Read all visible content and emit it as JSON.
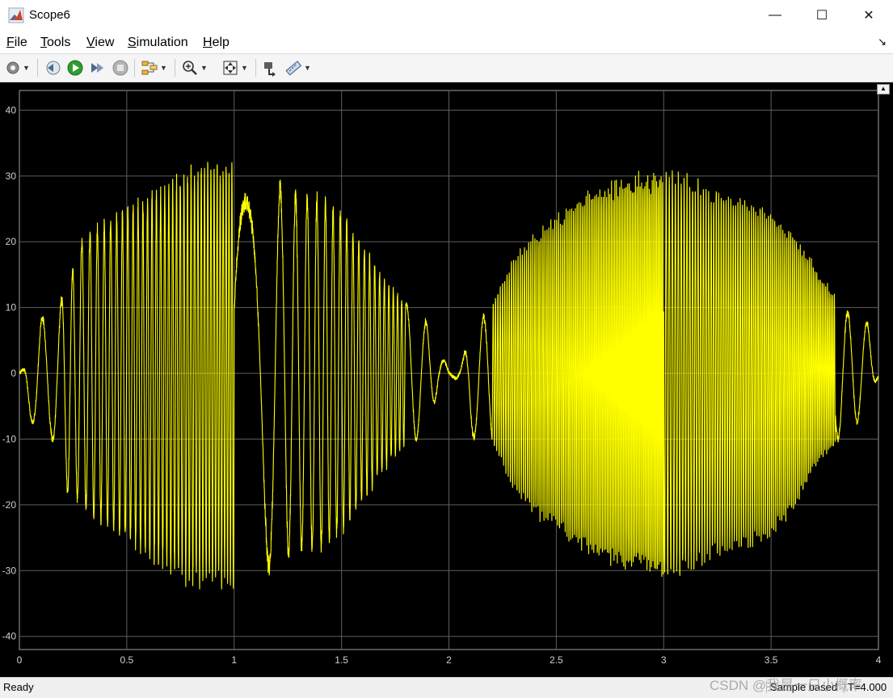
{
  "window": {
    "title": "Scope6",
    "minimize_label": "—",
    "maximize_label": "☐",
    "close_label": "✕"
  },
  "menu": {
    "items": [
      {
        "key": "F",
        "rest": "ile"
      },
      {
        "key": "T",
        "rest": "ools"
      },
      {
        "key": "V",
        "rest": "iew"
      },
      {
        "key": "S",
        "rest": "imulation"
      },
      {
        "key": "H",
        "rest": "elp"
      }
    ],
    "collapse_glyph": "↘"
  },
  "toolbar": {
    "icons": [
      "settings-icon",
      "step-back-icon",
      "run-icon",
      "step-forward-icon",
      "stop-icon",
      "signal-select-icon",
      "zoom-icon",
      "autoscale-icon",
      "highlight-block-icon",
      "measurements-icon"
    ]
  },
  "status": {
    "left": "Ready",
    "sample_mode": "Sample based",
    "time": "T=4.000"
  },
  "watermark": "CSDN @我是一只小概率",
  "colors": {
    "signal": "#ffff00",
    "plot_background": "#000000",
    "grid": "#5e5e5e",
    "tick_label": "#d0d0d0"
  },
  "chart_data": {
    "type": "line",
    "title": "",
    "xlabel": "",
    "ylabel": "",
    "xlim": [
      0,
      4
    ],
    "ylim": [
      -42,
      43
    ],
    "xticks": [
      0,
      0.5,
      1,
      1.5,
      2,
      2.5,
      3,
      3.5,
      4
    ],
    "xtick_labels": [
      "0",
      "0.5",
      "1",
      "1.5",
      "2",
      "2.5",
      "3",
      "3.5",
      "4"
    ],
    "yticks": [
      -40,
      -30,
      -20,
      -10,
      0,
      10,
      20,
      30,
      40
    ],
    "ytick_labels": [
      "-40",
      "-30",
      "-20",
      "-10",
      "0",
      "10",
      "20",
      "30",
      "40"
    ],
    "grid": true,
    "series": [
      {
        "color": "#ffff00",
        "peak_envelope": {
          "x": [
            0,
            0.05,
            0.1,
            0.15,
            0.2,
            0.3,
            0.4,
            0.5,
            0.6,
            0.7,
            0.8,
            0.9,
            1.0,
            1.1,
            1.2,
            1.3,
            1.4,
            1.5,
            1.6,
            1.7,
            1.8,
            1.9,
            1.95,
            2.0,
            2.05,
            2.1,
            2.2,
            2.3,
            2.4,
            2.5,
            2.6,
            2.7,
            2.8,
            2.9,
            3.0,
            3.1,
            3.2,
            3.3,
            3.4,
            3.5,
            3.6,
            3.7,
            3.8,
            3.9,
            3.95,
            4.0
          ],
          "upper": [
            0.5,
            1,
            9,
            8,
            12,
            22,
            24,
            26,
            28,
            30,
            32,
            33,
            33,
            32,
            30,
            28,
            28,
            25,
            20,
            15,
            11,
            8,
            4,
            0.5,
            1,
            6,
            11,
            18,
            22,
            24,
            27,
            29,
            30,
            31,
            32,
            31,
            29,
            28,
            27,
            25,
            22,
            17,
            12,
            8,
            8,
            0.5
          ],
          "lower": [
            -0.5,
            -8,
            -7,
            -10,
            -18,
            -21,
            -24,
            -26,
            -29,
            -31,
            -33,
            -33,
            -33,
            -32,
            -30,
            -28,
            -28,
            -25,
            -20,
            -15,
            -11,
            -10,
            -2,
            -0.5,
            -1,
            -10,
            -11,
            -18,
            -22,
            -24,
            -27,
            -29,
            -30,
            -31,
            -32,
            -31,
            -29,
            -28,
            -27,
            -25,
            -22,
            -15,
            -11,
            -8,
            -4,
            -0.5
          ]
        }
      }
    ]
  }
}
